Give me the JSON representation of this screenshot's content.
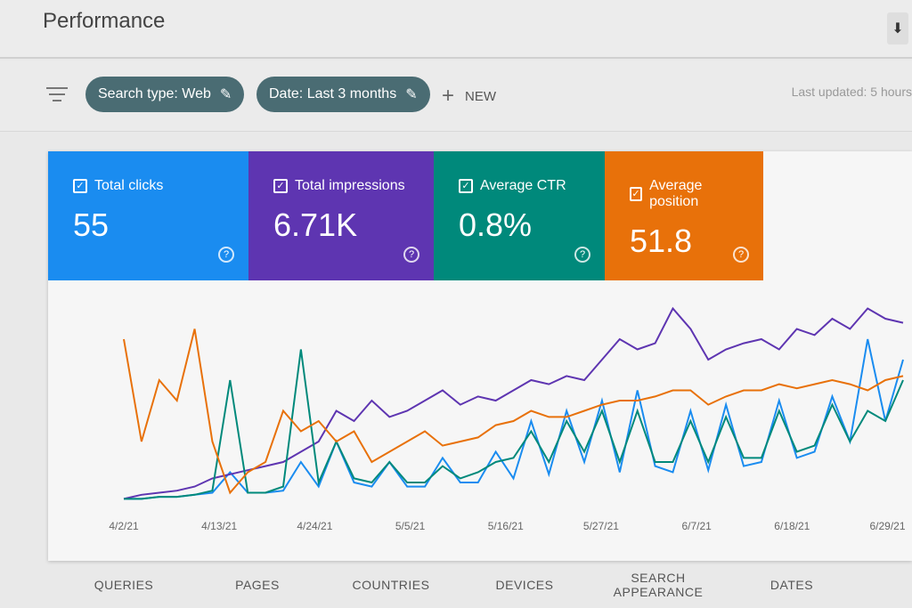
{
  "header": {
    "title": "Performance",
    "download_icon": "download-icon"
  },
  "filters": {
    "chips": [
      {
        "label": "Search type: Web"
      },
      {
        "label": "Date: Last 3 months"
      }
    ],
    "new_label": "NEW",
    "last_updated": "Last updated: 5 hours"
  },
  "cards": [
    {
      "label": "Total clicks",
      "value": "55",
      "color": "#1a8cf0"
    },
    {
      "label": "Total impressions",
      "value": "6.71K",
      "color": "#5e35b1"
    },
    {
      "label": "Average CTR",
      "value": "0.8%",
      "color": "#00897b"
    },
    {
      "label": "Average position",
      "value": "51.8",
      "color": "#e8710a"
    }
  ],
  "tabs": [
    "QUERIES",
    "PAGES",
    "COUNTRIES",
    "DEVICES",
    "SEARCH APPEARANCE",
    "DATES"
  ],
  "chart_data": {
    "type": "line",
    "x_tick_labels": [
      "4/2/21",
      "4/13/21",
      "4/24/21",
      "5/5/21",
      "5/16/21",
      "5/27/21",
      "6/7/21",
      "6/18/21",
      "6/29/21"
    ],
    "ylim": [
      0,
      100
    ],
    "grid": false,
    "series": [
      {
        "name": "Total clicks",
        "color": "#1a8cf0",
        "values": [
          2,
          2,
          3,
          3,
          4,
          5,
          15,
          5,
          5,
          6,
          20,
          8,
          30,
          10,
          8,
          20,
          8,
          8,
          22,
          10,
          10,
          25,
          12,
          40,
          14,
          45,
          20,
          50,
          15,
          55,
          18,
          15,
          45,
          16,
          48,
          18,
          20,
          50,
          22,
          25,
          52,
          30,
          80,
          40,
          70
        ]
      },
      {
        "name": "Total impressions",
        "color": "#5e35b1",
        "values": [
          2,
          4,
          5,
          6,
          8,
          12,
          14,
          16,
          18,
          20,
          25,
          30,
          45,
          40,
          50,
          42,
          45,
          50,
          55,
          48,
          52,
          50,
          55,
          60,
          58,
          62,
          60,
          70,
          80,
          75,
          78,
          95,
          85,
          70,
          75,
          78,
          80,
          75,
          85,
          82,
          90,
          85,
          95,
          90,
          88
        ]
      },
      {
        "name": "Average CTR",
        "color": "#00897b",
        "values": [
          2,
          2,
          3,
          3,
          4,
          6,
          60,
          5,
          5,
          8,
          75,
          10,
          30,
          12,
          10,
          20,
          10,
          10,
          18,
          12,
          15,
          20,
          22,
          35,
          20,
          40,
          25,
          45,
          20,
          45,
          20,
          20,
          40,
          20,
          42,
          22,
          22,
          45,
          25,
          28,
          48,
          30,
          45,
          40,
          60
        ]
      },
      {
        "name": "Average position",
        "color": "#e8710a",
        "values": [
          80,
          30,
          60,
          50,
          85,
          30,
          5,
          15,
          20,
          45,
          35,
          40,
          30,
          35,
          20,
          25,
          30,
          35,
          28,
          30,
          32,
          38,
          40,
          45,
          42,
          42,
          45,
          48,
          50,
          50,
          52,
          55,
          55,
          48,
          52,
          55,
          55,
          58,
          56,
          58,
          60,
          58,
          55,
          60,
          62
        ]
      }
    ]
  }
}
